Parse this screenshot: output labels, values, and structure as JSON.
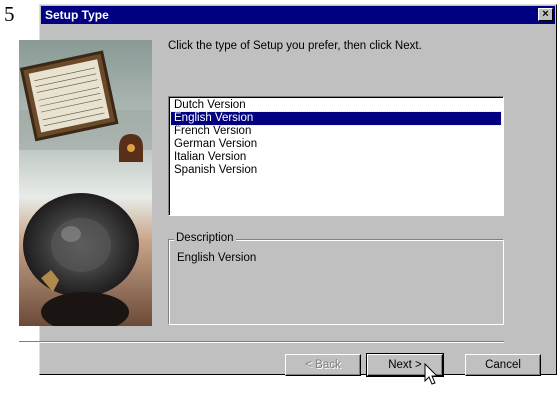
{
  "step_number": "5",
  "window": {
    "title": "Setup Type",
    "close_symbol": "×"
  },
  "instruction": "Click the type of Setup you prefer, then click Next.",
  "options": [
    "Dutch Version",
    "English Version",
    "French Version",
    "German Version",
    "Italian Version",
    "Spanish Version"
  ],
  "selected_option": "English Version",
  "description": {
    "label": "Description",
    "text": "English Version"
  },
  "buttons": {
    "back": "< Back",
    "next": "Next >",
    "cancel": "Cancel"
  },
  "colors": {
    "titlebar": "#000080",
    "selection": "#000080",
    "face": "#c0c0c0"
  },
  "icons": {
    "close": "close-icon",
    "cursor": "mouse-pointer-icon"
  }
}
